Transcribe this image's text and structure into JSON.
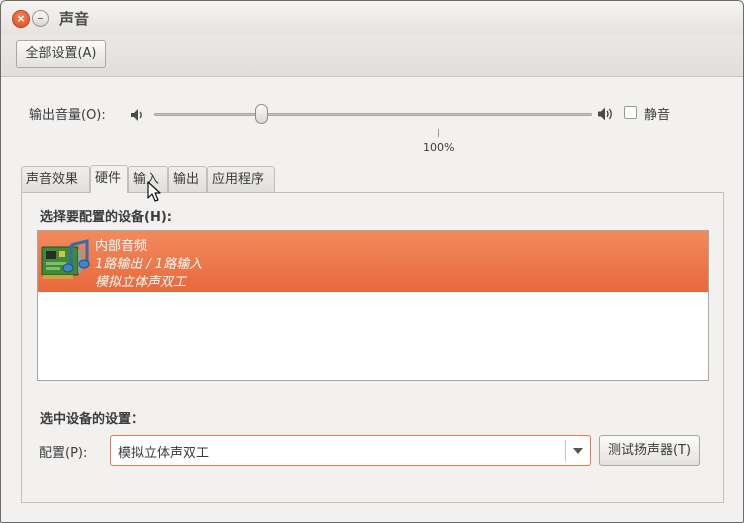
{
  "window": {
    "title": "声音",
    "close_glyph": "×",
    "minimize_glyph": "–"
  },
  "toolbar": {
    "all_settings_label": "全部设置(A)"
  },
  "output_volume": {
    "label": "输出音量(O):",
    "level_percent": 25,
    "tick_label": "100%",
    "mute_label": "静音",
    "muted": false,
    "low_icon": "speaker-low-icon",
    "high_icon": "speaker-high-icon"
  },
  "tabs": [
    {
      "label": "声音效果",
      "active": false
    },
    {
      "label": "硬件",
      "active": true
    },
    {
      "label": "输入",
      "active": false
    },
    {
      "label": "输出",
      "active": false
    },
    {
      "label": "应用程序",
      "active": false
    }
  ],
  "hardware": {
    "select_device_title": "选择要配置的设备(H):",
    "devices": [
      {
        "name": "内部音频",
        "channels": "1路输出 / 1路输入",
        "profile": "模拟立体声双工",
        "selected": true,
        "icon": "sound-card-icon"
      }
    ],
    "selected_settings_title": "选中设备的设置：",
    "profile_label": "配置(P):",
    "profile_value": "模拟立体声双工",
    "test_speakers_label": "测试扬声器(T)"
  },
  "colors": {
    "selection": "#e8693d",
    "accent_border": "#e47a4e"
  }
}
